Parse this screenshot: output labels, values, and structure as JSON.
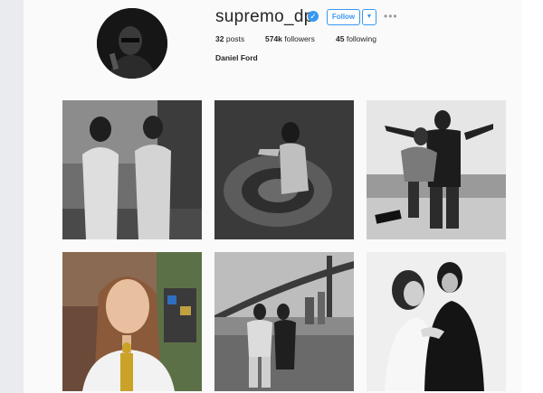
{
  "profile": {
    "username": "supremo_dp",
    "full_name": "Daniel Ford",
    "follow_label": "Follow",
    "dropdown_icon": "chevron-down-icon",
    "more_icon": "more-horizontal-icon",
    "verified_icon": "verified-badge-icon",
    "stats": {
      "posts_count": "32",
      "posts_label": "posts",
      "followers_count": "574k",
      "followers_label": "followers",
      "following_count": "45",
      "following_label": "following"
    }
  },
  "colors": {
    "accent": "#3897f0",
    "background": "#fafafa",
    "text": "#262626"
  },
  "posts": [
    {
      "id": 1,
      "kind": "photo-bw"
    },
    {
      "id": 2,
      "kind": "photo-bw"
    },
    {
      "id": 3,
      "kind": "photo-bw"
    },
    {
      "id": 4,
      "kind": "photo-color"
    },
    {
      "id": 5,
      "kind": "photo-bw"
    },
    {
      "id": 6,
      "kind": "photo-bw"
    }
  ]
}
